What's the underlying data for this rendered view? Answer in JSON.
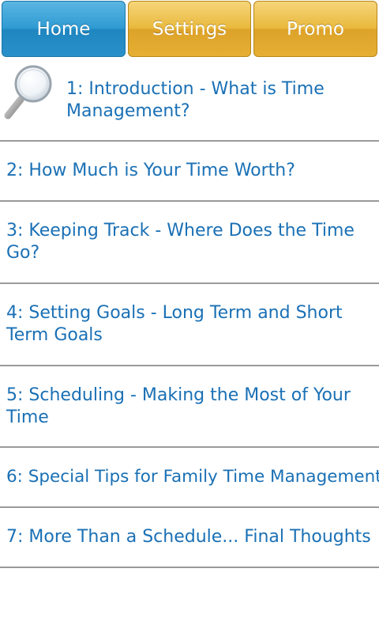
{
  "tabs": {
    "home": "Home",
    "settings": "Settings",
    "promo": "Promo"
  },
  "chapters": [
    {
      "label": "1: Introduction - What is Time Management?"
    },
    {
      "label": "2: How Much is Your Time Worth?"
    },
    {
      "label": "3: Keeping Track - Where Does the Time Go?"
    },
    {
      "label": "4: Setting Goals - Long Term and Short Term Goals"
    },
    {
      "label": "5: Scheduling - Making the Most of Your Time"
    },
    {
      "label": "6: Special Tips for Family Time Management"
    },
    {
      "label": "7: More Than a Schedule... Final Thoughts"
    }
  ],
  "icons": {
    "search": "magnifying-glass-icon"
  },
  "colors": {
    "link_text": "#1a70b5",
    "tab_active": "#2f9bd3",
    "tab_inactive": "#e9b93e",
    "divider": "#9a9a9a"
  }
}
